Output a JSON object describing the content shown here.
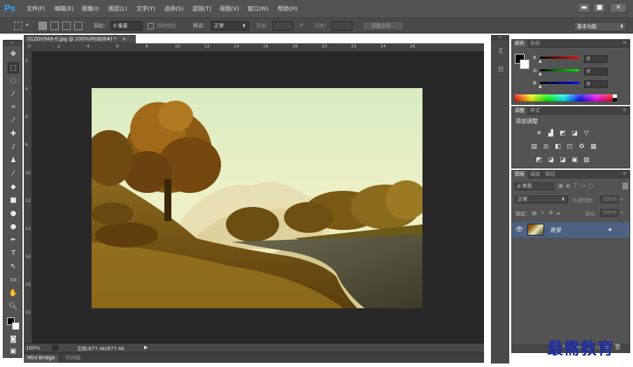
{
  "app": {
    "logo": "Ps"
  },
  "menu": [
    "文件(F)",
    "编辑(E)",
    "图像(I)",
    "图层(L)",
    "文字(Y)",
    "选择(S)",
    "滤镜(T)",
    "视图(V)",
    "窗口(W)",
    "帮助(H)"
  ],
  "window_controls": [
    "▬",
    "■",
    "✕"
  ],
  "options": {
    "feather_label": "羽化:",
    "feather_value": "0 像素",
    "antialias_label": "消除锯齿",
    "style_label": "样式:",
    "style_value": "正常",
    "width_label": "宽度:",
    "height_label": "高度:",
    "refine_edge": "调整边缘..."
  },
  "workspace": "基本功能",
  "document": {
    "tab_title": "012GV949-0.jpg @ 100%(RGB/8#) *",
    "tab_close": "×",
    "zoom": "100%",
    "doc_size": "文档:877.4K/877.4K",
    "ruler_top": [
      "0",
      "2",
      "4",
      "6",
      "8",
      "10",
      "12",
      "14",
      "16",
      "18",
      "20",
      "22",
      "24",
      "26"
    ],
    "ruler_left": [
      "2",
      "4",
      "6",
      "8",
      "10",
      "12",
      "14",
      "16",
      "18",
      "20"
    ]
  },
  "bottom_tabs": {
    "mini_bridge": "Mini Bridge",
    "timeline": "时间轴"
  },
  "color_panel": {
    "tabs": [
      "颜色",
      "色板"
    ],
    "channels": [
      {
        "label": "R",
        "value": "0"
      },
      {
        "label": "G",
        "value": "0"
      },
      {
        "label": "B",
        "value": "0"
      }
    ]
  },
  "adjust_panel": {
    "tabs": [
      "调整",
      "样式"
    ],
    "heading": "添加调整"
  },
  "layers_panel": {
    "tabs": [
      "图层",
      "通道",
      "路径"
    ],
    "kind": "ρ 类型",
    "blend_mode": "正常",
    "opacity_label": "不透明度:",
    "opacity_value": "100%",
    "lock_label": "锁定:",
    "fill_label": "填充:",
    "fill_value": "100%",
    "layer_name": "背景"
  },
  "watermark": "最需教育",
  "colors": {
    "menubar": "#535353",
    "canvas_bg": "#282828",
    "selected_layer": "#4d6283"
  }
}
